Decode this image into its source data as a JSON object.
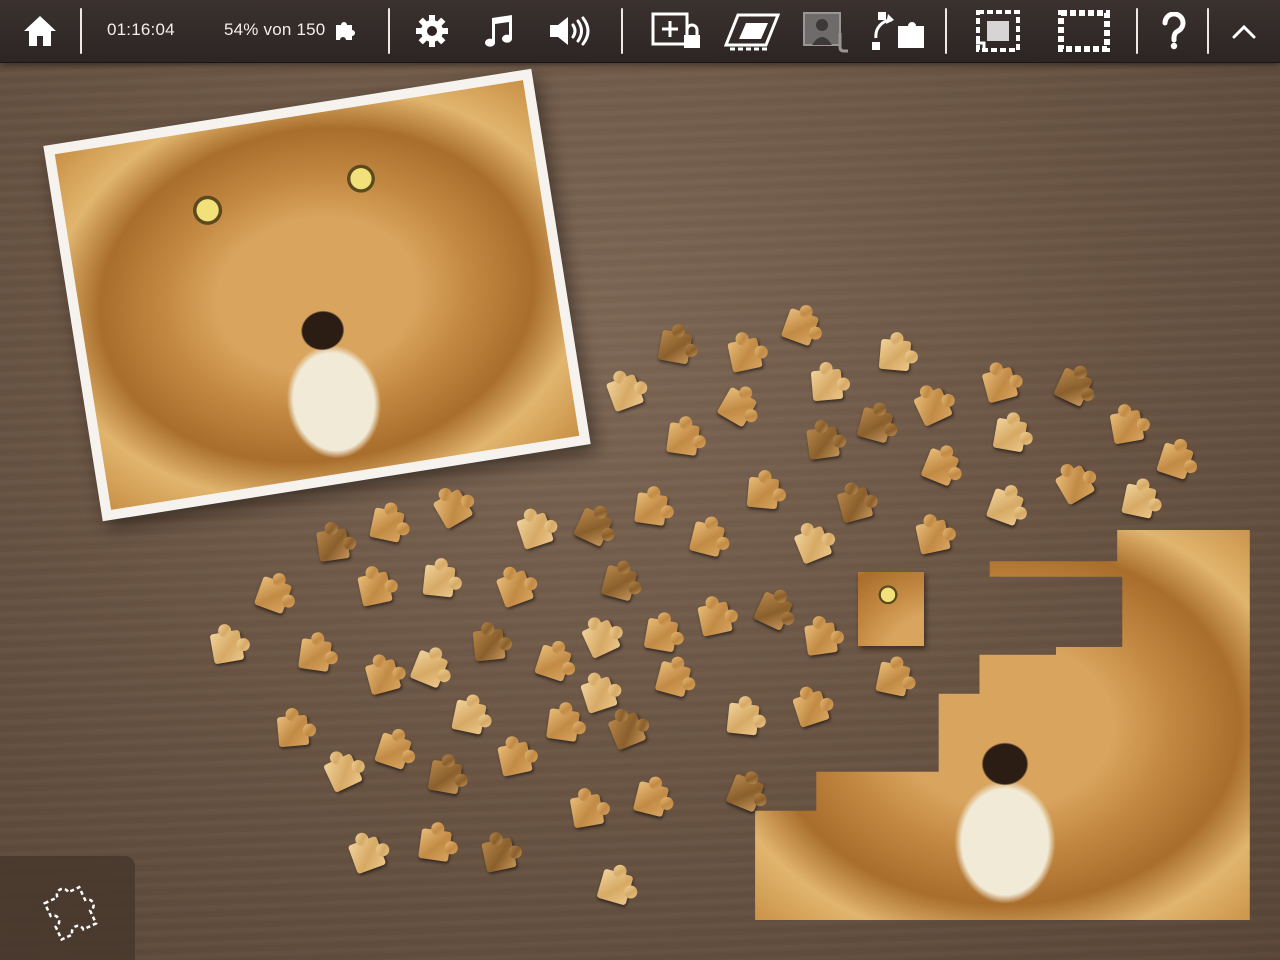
{
  "toolbar": {
    "timer": "01:16:04",
    "progress": "54% von 150",
    "buttons": [
      {
        "name": "home-icon"
      },
      {
        "name": "gear-icon"
      },
      {
        "name": "music-note-icon"
      },
      {
        "name": "speaker-volume-icon"
      },
      {
        "name": "lock-zoom-icon"
      },
      {
        "name": "edge-pieces-icon"
      },
      {
        "name": "ghost-image-icon"
      },
      {
        "name": "shuffle-pieces-icon"
      },
      {
        "name": "frame-sort-icon"
      },
      {
        "name": "border-only-icon"
      },
      {
        "name": "help-icon"
      },
      {
        "name": "chevron-up-icon"
      }
    ]
  },
  "puzzle": {
    "total_pieces": 150,
    "percent_complete": 54,
    "subject": "lion-face"
  },
  "colors": {
    "toolbar_bg": "#2e2624",
    "table_wood": "#6c5645",
    "icon_white": "#ffffff"
  }
}
